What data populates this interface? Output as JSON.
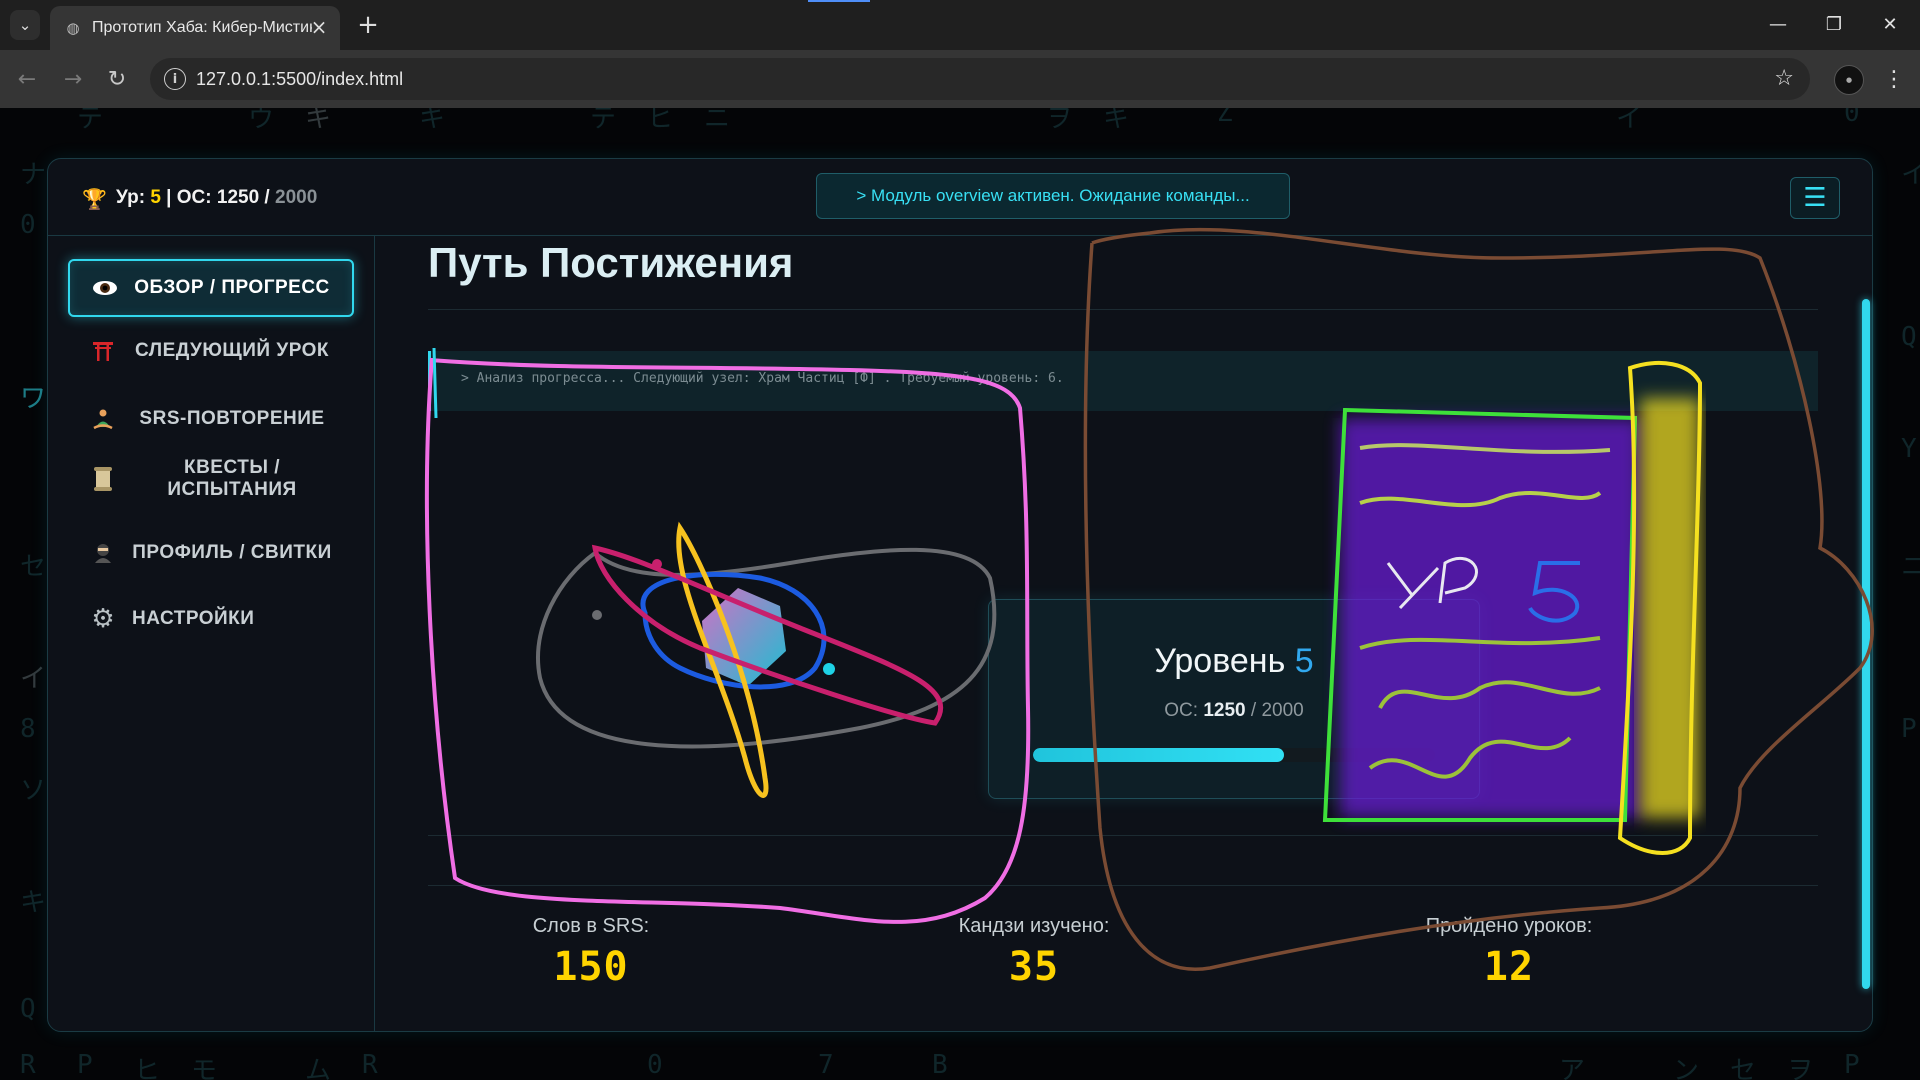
{
  "browser": {
    "tab_title": "Прототип Хаба: Кибер-Мистика",
    "url": "127.0.0.1:5500/index.html"
  },
  "header": {
    "stats_prefix": "Ур: ",
    "level": "5",
    "separator": " | ",
    "xp_prefix": "ОС: ",
    "xp": "1250",
    "xp_sep": " / ",
    "xp_max": "2000",
    "status_text": "> Модуль overview активен. Ожидание команды..."
  },
  "sidebar": {
    "items": [
      {
        "label": "ОБЗОР / ПРОГРЕСС",
        "icon": "eye-icon",
        "active": true
      },
      {
        "label": "СЛЕДУЮЩИЙ УРОК",
        "icon": "torii-icon",
        "active": false
      },
      {
        "label": "SRS-ПОВТОРЕНИЕ",
        "icon": "meditation-icon",
        "active": false
      },
      {
        "label": "КВЕСТЫ / ИСПЫТАНИЯ",
        "icon": "scroll-icon",
        "active": false
      },
      {
        "label": "ПРОФИЛЬ / СВИТКИ",
        "icon": "ninja-icon",
        "active": false
      },
      {
        "label": "НАСТРОЙКИ",
        "icon": "gear-icon",
        "active": false
      }
    ]
  },
  "main": {
    "title": "Путь Постижения",
    "console": "> Анализ прогресса... Следующий узел: Храм Частиц [Ф] . Требуемый уровень: 6.",
    "level_card": {
      "label": "Уровень ",
      "level": "5",
      "xp_label": "ОС: ",
      "xp": "1250",
      "xp_sep": " / ",
      "xp_max": "2000",
      "progress": 0.625
    },
    "stats": [
      {
        "label": "Слов в SRS:",
        "value": "150"
      },
      {
        "label": "Кандзи изучено:",
        "value": "35"
      },
      {
        "label": "Пройдено уроков:",
        "value": "12"
      }
    ]
  },
  "scribble_text": "УР 5"
}
